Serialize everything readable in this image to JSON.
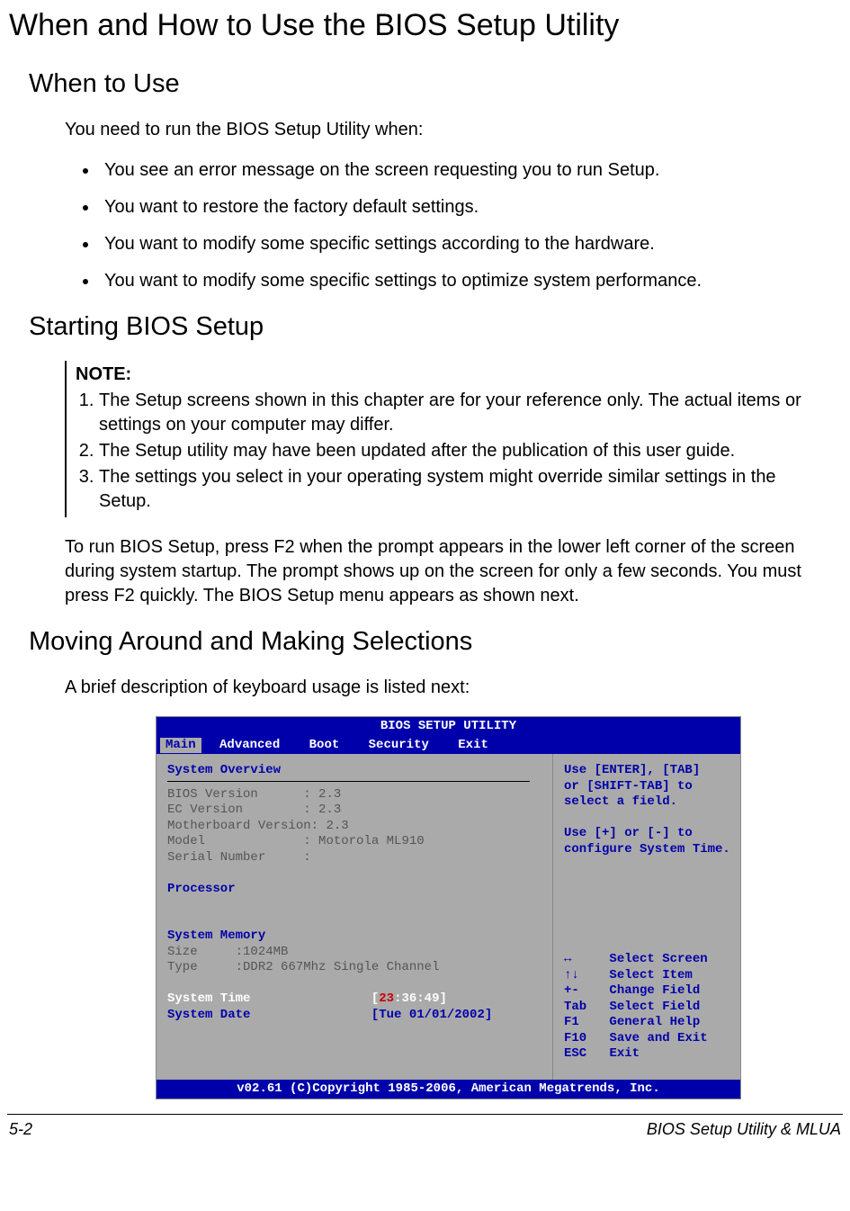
{
  "h1": "When and How to Use the BIOS Setup Utility",
  "when": {
    "heading": "When to Use",
    "intro": "You need to run the BIOS Setup Utility when:",
    "bullets": [
      "You see an error message on the screen requesting you to run Setup.",
      "You want to restore the factory default settings.",
      "You want to modify some specific settings according to the hardware.",
      "You want to modify some specific settings to optimize system performance."
    ]
  },
  "starting": {
    "heading": "Starting BIOS Setup",
    "note_label": "NOTE:",
    "notes": [
      "The Setup screens shown in this chapter are for your reference only. The actual items or settings on your computer may differ.",
      "The Setup utility may have been updated after the publication of this user guide.",
      "The settings you select in your operating system might override similar settings in the Setup."
    ],
    "para": "To run BIOS Setup, press F2 when the prompt appears in the lower left corner of the screen during system startup. The prompt shows up on the screen for only a few seconds. You must press F2 quickly. The BIOS Setup menu appears as shown next."
  },
  "moving": {
    "heading": "Moving Around and Making Selections",
    "intro": "A brief description of keyboard usage is listed next:"
  },
  "bios": {
    "title": "BIOS SETUP UTILITY",
    "tabs": [
      "Main",
      "Advanced",
      "Boot",
      "Security",
      "Exit"
    ],
    "overview_heading": "System Overview",
    "rows": {
      "bios_version_label": "BIOS Version",
      "bios_version_value": "2.3",
      "ec_version_label": "EC Version",
      "ec_version_value": "2.3",
      "mb_version_label": "Motherboard Version:",
      "mb_version_value": "2.3",
      "model_label": "Model",
      "model_value": "Motorola ML910",
      "serial_label": "Serial Number",
      "serial_value": ""
    },
    "processor_heading": "Processor",
    "memory_heading": "System Memory",
    "memory": {
      "size_label": "Size",
      "size_value": "1024MB",
      "type_label": "Type",
      "type_value": "DDR2 667Mhz Single Channel"
    },
    "time_label": "System Time",
    "time_value_prefix": "[",
    "time_hh": "23",
    "time_rest": ":36:49]",
    "date_label": "System Date",
    "date_value": "[Tue 01/01/2002]",
    "help_top": [
      "Use [ENTER], [TAB]",
      "or [SHIFT-TAB] to",
      "select a field.",
      "",
      "Use [+] or [-] to",
      "configure System Time."
    ],
    "help_bottom": [
      {
        "k": "↔",
        "v": "Select Screen"
      },
      {
        "k": "↑↓",
        "v": "Select Item"
      },
      {
        "k": "+-",
        "v": "Change Field"
      },
      {
        "k": "Tab",
        "v": "Select Field"
      },
      {
        "k": "F1",
        "v": "General Help"
      },
      {
        "k": "F10",
        "v": "Save and Exit"
      },
      {
        "k": "ESC",
        "v": "Exit"
      }
    ],
    "footer": "v02.61 (C)Copyright 1985-2006, American Megatrends, Inc."
  },
  "footer": {
    "page": "5-2",
    "title": "BIOS Setup Utility & MLUA"
  }
}
